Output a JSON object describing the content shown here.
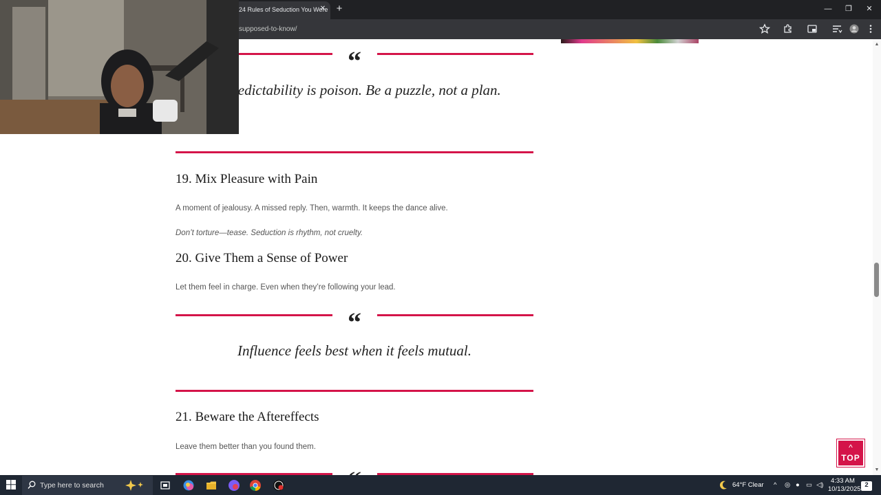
{
  "browser": {
    "tab_title": "24 Rules of Seduction You Were",
    "tab_close_glyph": "✕",
    "new_tab_glyph": "+",
    "url": "supposed-to-know/",
    "window_controls": {
      "minimize": "—",
      "restore": "❐",
      "close": "✕"
    },
    "toolbar_icons": [
      "star-icon",
      "extensions-icon",
      "cast-icon",
      "reading-list-icon",
      "profile-icon",
      "menu-icon"
    ]
  },
  "article": {
    "quote_mark": "“",
    "quote1": "Unpredictability is poison. Be a puzzle, not a plan.",
    "rule19": {
      "heading": "19. Mix Pleasure with Pain",
      "p1": "A moment of jealousy. A missed reply. Then, warmth. It keeps the dance alive.",
      "p2": "Don’t torture—tease. Seduction is rhythm, not cruelty."
    },
    "rule20": {
      "heading": "20. Give Them a Sense of Power",
      "p1": "Let them feel in charge. Even when they’re following your lead."
    },
    "quote2": "Influence feels best when it feels mutual.",
    "rule21": {
      "heading": "21. Beware the Aftereffects",
      "p1": "Leave them better than you found them."
    },
    "top_button": {
      "arrow": "^",
      "label": "TOP"
    }
  },
  "taskbar": {
    "search_placeholder": "Type here to search",
    "weather": "64°F  Clear",
    "time": "4:33 AM",
    "date": "10/13/2025",
    "notification_count": "2"
  },
  "colors": {
    "accent": "#d41449",
    "chrome_dark": "#202124",
    "chrome_toolbar": "#35363a",
    "taskbar": "#1f2733"
  }
}
